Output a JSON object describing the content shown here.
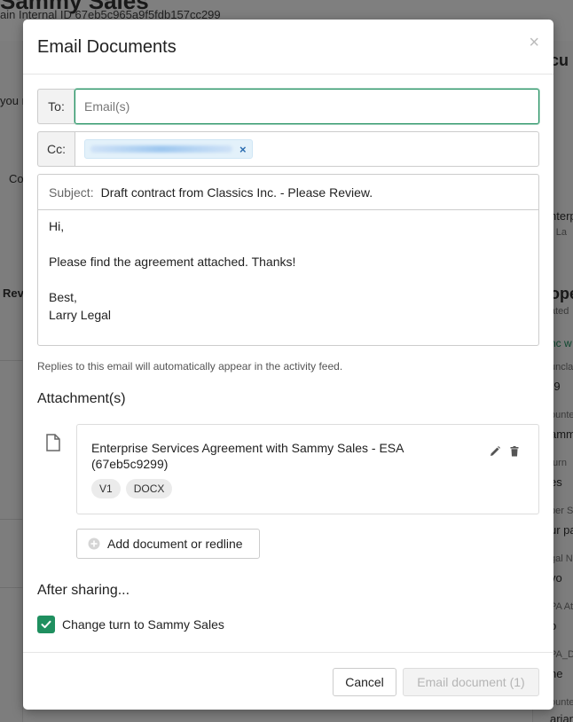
{
  "background": {
    "page_title": "Sammy Sales",
    "page_subtitle": "ain Internal ID 67eb5c965a9f5fdb157cc299",
    "left_snippets": [
      "you r",
      "Co",
      "Rev"
    ],
    "right_snippets": [
      "cu",
      "nterp",
      "· La",
      "ope",
      "ated",
      "nc w",
      "uncla",
      "-9",
      "ounte",
      "amm",
      "turn",
      "es",
      "per S",
      "ur pa",
      "gal N",
      "vo",
      "PA At",
      "o",
      "PA_D",
      "ne",
      "ounte",
      "arianz"
    ]
  },
  "modal": {
    "title": "Email Documents",
    "close_glyph": "×",
    "to": {
      "label": "To:",
      "placeholder": "Email(s)",
      "value": ""
    },
    "cc": {
      "label": "Cc:",
      "chip_remove_glyph": "×"
    },
    "subject": {
      "label": "Subject:",
      "value": "Draft contract from Classics Inc. - Please Review."
    },
    "body_lines": [
      "Hi,",
      "",
      "Please find the agreement attached. Thanks!",
      "",
      "Best,",
      "Larry Legal"
    ],
    "hint": "Replies to this email will automatically appear in the activity feed.",
    "attachments_title": "Attachment(s)",
    "attachment": {
      "name": "Enterprise Services Agreement with Sammy Sales - ESA (67eb5c9299)",
      "tags": [
        "V1",
        "DOCX"
      ],
      "icons": {
        "file": "document-icon",
        "edit": "pencil-icon",
        "delete": "trash-icon"
      }
    },
    "add_document_label": "Add document or redline",
    "after_sharing_title": "After sharing...",
    "change_turn_label": "Change turn to Sammy Sales",
    "change_turn_checked": true,
    "cancel_label": "Cancel",
    "send_label": "Email document (1)"
  },
  "colors": {
    "accent": "#1f8f5f",
    "chip_bg": "#e3f1fa",
    "disabled_text": "#b5b5b5"
  }
}
